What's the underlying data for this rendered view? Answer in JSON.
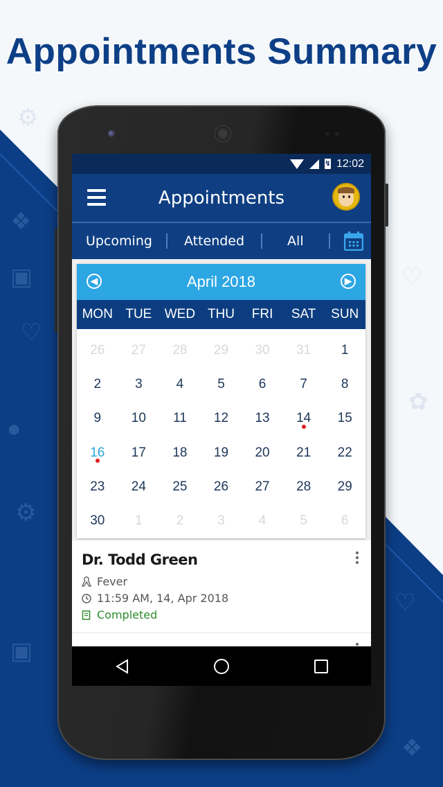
{
  "headline": "Appointments Summary",
  "status_bar": {
    "time": "12:02"
  },
  "app_bar": {
    "title": "Appointments"
  },
  "tabs": [
    {
      "label": "Upcoming"
    },
    {
      "label": "Attended"
    },
    {
      "label": "All"
    }
  ],
  "calendar": {
    "month_label": "April 2018",
    "weekdays": [
      "MON",
      "TUE",
      "WED",
      "THU",
      "FRI",
      "SAT",
      "SUN"
    ],
    "days": [
      {
        "d": "26",
        "muted": true
      },
      {
        "d": "27",
        "muted": true
      },
      {
        "d": "28",
        "muted": true
      },
      {
        "d": "29",
        "muted": true
      },
      {
        "d": "30",
        "muted": true
      },
      {
        "d": "31",
        "muted": true
      },
      {
        "d": "1"
      },
      {
        "d": "2"
      },
      {
        "d": "3"
      },
      {
        "d": "4"
      },
      {
        "d": "5"
      },
      {
        "d": "6"
      },
      {
        "d": "7"
      },
      {
        "d": "8"
      },
      {
        "d": "9"
      },
      {
        "d": "10"
      },
      {
        "d": "11"
      },
      {
        "d": "12"
      },
      {
        "d": "13"
      },
      {
        "d": "14",
        "event": true
      },
      {
        "d": "15"
      },
      {
        "d": "16",
        "today": true,
        "event": true
      },
      {
        "d": "17"
      },
      {
        "d": "18"
      },
      {
        "d": "19"
      },
      {
        "d": "20"
      },
      {
        "d": "21"
      },
      {
        "d": "22"
      },
      {
        "d": "23"
      },
      {
        "d": "24"
      },
      {
        "d": "25"
      },
      {
        "d": "26"
      },
      {
        "d": "27"
      },
      {
        "d": "28"
      },
      {
        "d": "29"
      },
      {
        "d": "30"
      },
      {
        "d": "1",
        "muted": true
      },
      {
        "d": "2",
        "muted": true
      },
      {
        "d": "3",
        "muted": true
      },
      {
        "d": "4",
        "muted": true
      },
      {
        "d": "5",
        "muted": true
      },
      {
        "d": "6",
        "muted": true
      }
    ]
  },
  "appointments": [
    {
      "doctor": "Dr. Todd Green",
      "reason": "Fever",
      "datetime": "11:59 AM, 14, Apr 2018",
      "status": "Completed"
    }
  ],
  "colors": {
    "brand_blue": "#0f3f82",
    "calendar_header": "#2da6e4",
    "event_dot": "#e01a1a",
    "today": "#2aa3d8",
    "status_completed": "#2e8b2e"
  }
}
